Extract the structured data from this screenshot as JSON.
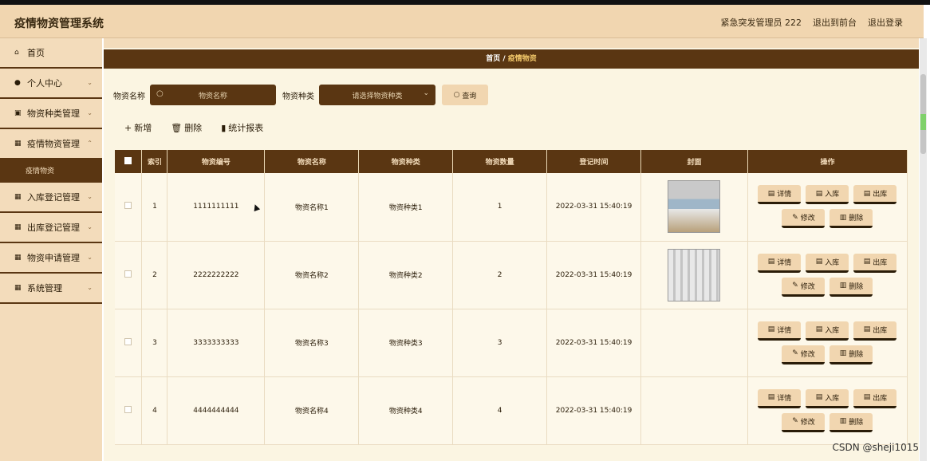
{
  "header": {
    "title": "疫情物资管理系统",
    "user": "紧急突发管理员 222",
    "to_front": "退出到前台",
    "logout": "退出登录"
  },
  "sidebar": {
    "items": [
      {
        "icon": "home-icon",
        "label": "首页"
      },
      {
        "icon": "user-icon",
        "label": "个人中心"
      },
      {
        "icon": "category-icon",
        "label": "物资种类管理"
      },
      {
        "icon": "grid-icon",
        "label": "疫情物资管理"
      },
      {
        "icon": "grid-icon",
        "label": "入库登记管理"
      },
      {
        "icon": "grid-icon",
        "label": "出库登记管理"
      },
      {
        "icon": "grid-icon",
        "label": "物资申请管理"
      },
      {
        "icon": "grid-icon",
        "label": "系统管理"
      }
    ],
    "active_sub": "疫情物资"
  },
  "breadcrumb": {
    "home": "首页",
    "sep": "/",
    "current": "疫情物资"
  },
  "search": {
    "name_label": "物资名称",
    "name_placeholder": "物资名称",
    "type_label": "物资种类",
    "type_placeholder": "请选择物资种类",
    "query_button": "查询"
  },
  "actions": {
    "add": "新增",
    "delete": "删除",
    "report": "统计报表"
  },
  "table": {
    "headers": [
      "",
      "索引",
      "物资编号",
      "物资名称",
      "物资种类",
      "物资数量",
      "登记时间",
      "封面",
      "操作"
    ],
    "rows": [
      {
        "index": "1",
        "code": "1111111111",
        "name": "物资名称1",
        "type": "物资种类1",
        "qty": "1",
        "time": "2022-03-31 15:40:19",
        "cover": "thumb1"
      },
      {
        "index": "2",
        "code": "2222222222",
        "name": "物资名称2",
        "type": "物资种类2",
        "qty": "2",
        "time": "2022-03-31 15:40:19",
        "cover": "thumb2"
      },
      {
        "index": "3",
        "code": "3333333333",
        "name": "物资名称3",
        "type": "物资种类3",
        "qty": "3",
        "time": "2022-03-31 15:40:19",
        "cover": ""
      },
      {
        "index": "4",
        "code": "4444444444",
        "name": "物资名称4",
        "type": "物资种类4",
        "qty": "4",
        "time": "2022-03-31 15:40:19",
        "cover": ""
      }
    ],
    "ops": {
      "detail": "详情",
      "in": "入库",
      "out": "出库",
      "edit": "修改",
      "delete": "删除"
    }
  },
  "watermark": "CSDN @sheji1015",
  "colors": {
    "header_bg": "#f1d6b0",
    "dark_brown": "#5a3612",
    "main_bg": "#fbf5e2"
  }
}
